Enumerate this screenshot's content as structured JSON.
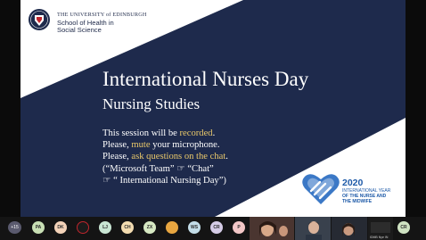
{
  "slide": {
    "header": {
      "university": "THE UNIVERSITY of EDINBURGH",
      "school_line1": "School of Health in",
      "school_line2": "Social Science"
    },
    "title": "International Nurses Day",
    "subtitle": "Nursing Studies",
    "notes": {
      "l1_pre": "This session will be ",
      "l1_hl": "recorded",
      "l1_post": ".",
      "l2_pre": "Please, ",
      "l2_hl": "mute",
      "l2_post": " your microphone.",
      "l3_pre": "Please, ",
      "l3_hl": "ask questions on the chat",
      "l3_post": ".",
      "l4": "(“Microsoft Team” ☞ “Chat”",
      "l5": "☞ “ International Nursing Day”)"
    },
    "year_badge": {
      "year": "2020",
      "line1": "INTERNATIONAL YEAR",
      "line2": "OF THE NURSE AND",
      "line3": "THE MIDWIFE"
    },
    "colors": {
      "navy": "#1e2a4c",
      "highlight": "#e9c86a",
      "badge_blue": "#1e5aa8"
    }
  },
  "participants": {
    "overflow_count": "+15",
    "avatars": [
      {
        "initials": "PA",
        "color": "#c8dfb4"
      },
      {
        "initials": "DK",
        "color": "#f3d2b8"
      },
      {
        "initials": "",
        "color": "#1b1b1b"
      },
      {
        "initials": "LJ",
        "color": "#c9e6d4"
      },
      {
        "initials": "CH",
        "color": "#f3dcb0"
      },
      {
        "initials": "ZX",
        "color": "#d6e8c2"
      },
      {
        "initials": "",
        "color": "#e8a640"
      },
      {
        "initials": "WS",
        "color": "#c3dde8"
      },
      {
        "initials": "CR",
        "color": "#d5cce6"
      },
      {
        "initials": "P",
        "color": "#f2c7c7"
      }
    ],
    "last_avatar": {
      "initials": "CR",
      "color": "#cfe3c2"
    },
    "tile_caption": "IDMB Nye IN"
  }
}
